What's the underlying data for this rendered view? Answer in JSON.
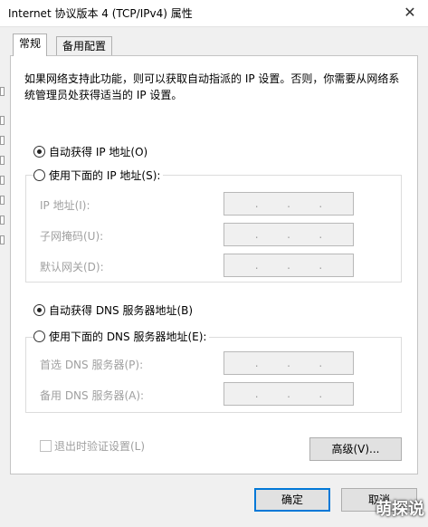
{
  "window": {
    "title": "Internet 协议版本 4 (TCP/IPv4) 属性",
    "close_glyph": "✕"
  },
  "tabs": [
    {
      "label": "常规",
      "active": true
    },
    {
      "label": "备用配置",
      "active": false
    }
  ],
  "description": "如果网络支持此功能，则可以获取自动指派的 IP 设置。否则，你需要从网络系统管理员处获得适当的 IP 设置。",
  "ip_section": {
    "auto_label": "自动获得 IP 地址(O)",
    "auto_selected": true,
    "manual_label": "使用下面的 IP 地址(S):",
    "fields": [
      {
        "label": "IP 地址(I):",
        "dots": [
          ".",
          ".",
          "."
        ]
      },
      {
        "label": "子网掩码(U):",
        "dots": [
          ".",
          ".",
          "."
        ]
      },
      {
        "label": "默认网关(D):",
        "dots": [
          ".",
          ".",
          "."
        ]
      }
    ]
  },
  "dns_section": {
    "auto_label": "自动获得 DNS 服务器地址(B)",
    "auto_selected": true,
    "manual_label": "使用下面的 DNS 服务器地址(E):",
    "fields": [
      {
        "label": "首选 DNS 服务器(P):",
        "dots": [
          ".",
          ".",
          "."
        ]
      },
      {
        "label": "备用 DNS 服务器(A):",
        "dots": [
          ".",
          ".",
          "."
        ]
      }
    ]
  },
  "validate_on_exit": {
    "label": "退出时验证设置(L)",
    "checked": false
  },
  "advanced_button": "高级(V)...",
  "ok_button": "确定",
  "cancel_button": "取消",
  "watermark": "萌探说",
  "colors": {
    "accent": "#0078d7",
    "disabled_text": "#a0a0a0",
    "panel_bg": "#ffffff",
    "dialog_bg": "#f0f0f0"
  }
}
